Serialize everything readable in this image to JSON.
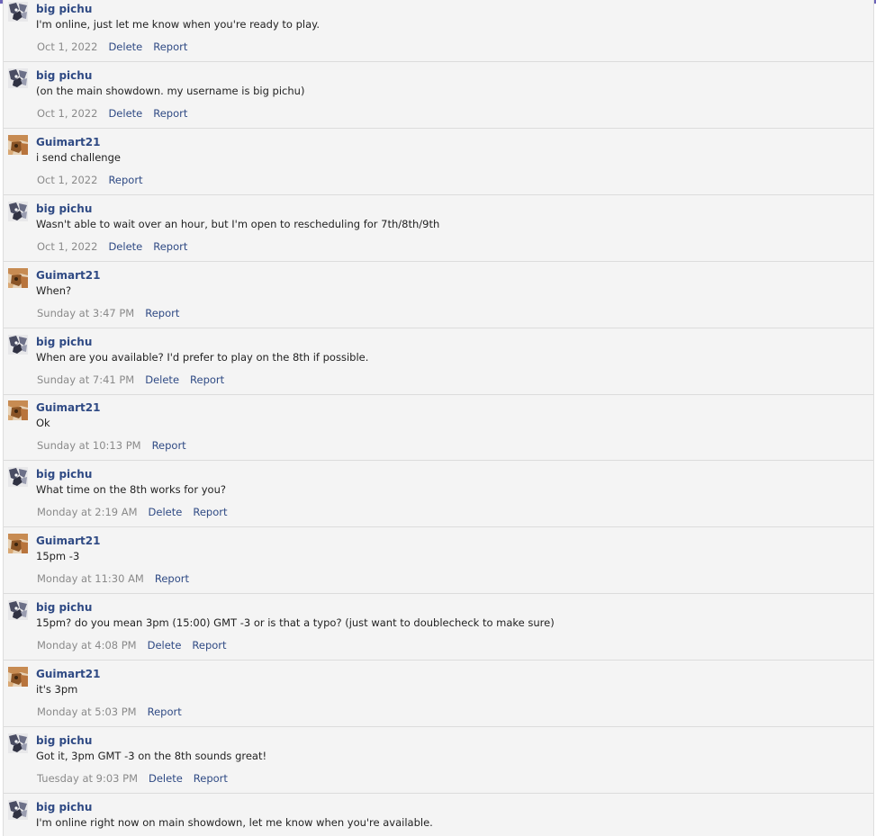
{
  "messages": [
    {
      "author": "big pichu",
      "avatar": "pichu-avatar",
      "text": "I'm online, just let me know when you're ready to play.",
      "time": "Oct 1, 2022",
      "delete": "Delete",
      "report": "Report"
    },
    {
      "author": "big pichu",
      "avatar": "pichu-avatar",
      "text": "(on the main showdown. my username is big pichu)",
      "time": "Oct 1, 2022",
      "delete": "Delete",
      "report": "Report"
    },
    {
      "author": "Guimart21",
      "avatar": "guimart-avatar",
      "text": "i send challenge",
      "time": "Oct 1, 2022",
      "report": "Report"
    },
    {
      "author": "big pichu",
      "avatar": "pichu-avatar",
      "text": "Wasn't able to wait over an hour, but I'm open to rescheduling for 7th/8th/9th",
      "time": "Oct 1, 2022",
      "delete": "Delete",
      "report": "Report"
    },
    {
      "author": "Guimart21",
      "avatar": "guimart-avatar",
      "text": "When?",
      "time": "Sunday at 3:47 PM",
      "report": "Report"
    },
    {
      "author": "big pichu",
      "avatar": "pichu-avatar",
      "text": "When are you available? I'd prefer to play on the 8th if possible.",
      "time": "Sunday at 7:41 PM",
      "delete": "Delete",
      "report": "Report"
    },
    {
      "author": "Guimart21",
      "avatar": "guimart-avatar",
      "text": "Ok",
      "time": "Sunday at 10:13 PM",
      "report": "Report"
    },
    {
      "author": "big pichu",
      "avatar": "pichu-avatar",
      "text": "What time on the 8th works for you?",
      "time": "Monday at 2:19 AM",
      "delete": "Delete",
      "report": "Report"
    },
    {
      "author": "Guimart21",
      "avatar": "guimart-avatar",
      "text": "15pm -3",
      "time": "Monday at 11:30 AM",
      "report": "Report"
    },
    {
      "author": "big pichu",
      "avatar": "pichu-avatar",
      "text": "15pm? do you mean 3pm (15:00) GMT -3 or is that a typo? (just want to doublecheck to make sure)",
      "time": "Monday at 4:08 PM",
      "delete": "Delete",
      "report": "Report"
    },
    {
      "author": "Guimart21",
      "avatar": "guimart-avatar",
      "text": "it's 3pm",
      "time": "Monday at 5:03 PM",
      "report": "Report"
    },
    {
      "author": "big pichu",
      "avatar": "pichu-avatar",
      "text": "Got it, 3pm GMT -3 on the 8th sounds great!",
      "time": "Tuesday at 9:03 PM",
      "delete": "Delete",
      "report": "Report"
    },
    {
      "author": "big pichu",
      "avatar": "pichu-avatar",
      "text": "I'm online right now on main showdown, let me know when you're available."
    }
  ]
}
